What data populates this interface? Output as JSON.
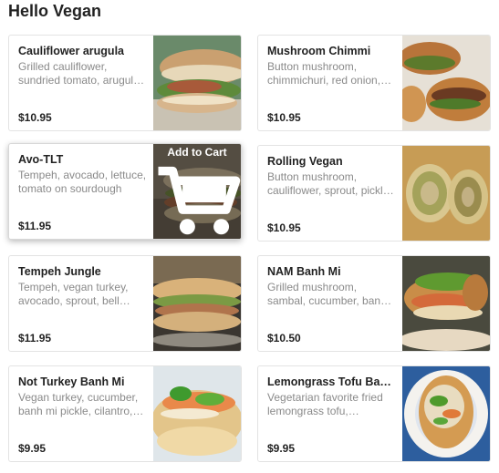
{
  "header": {
    "title": "Hello Vegan"
  },
  "menu_items": [
    {
      "name": "Cauliflower arugula",
      "description": "Grilled cauliflower, sundried tomato, arugula, pickled onion",
      "price": "$10.95"
    },
    {
      "name": "Mushroom Chimmi",
      "description": "Button mushroom, chimmichuri, red onion, arugula",
      "price": "$10.95"
    },
    {
      "name": "Avo-TLT",
      "description": "Tempeh, avocado, lettuce, tomato on sourdough",
      "price": "$11.95",
      "hover_label": "Add to Cart"
    },
    {
      "name": "Rolling Vegan",
      "description": "Button mushroom, cauliflower, sprout, pickled onion",
      "price": "$10.95"
    },
    {
      "name": "Tempeh Jungle",
      "description": "Tempeh, vegan turkey, avocado, sprout, bell pepper",
      "price": "$11.95"
    },
    {
      "name": "NAM Banh Mi",
      "description": "Grilled mushroom, sambal, cucumber, banh mi pickle, cilantro",
      "price": "$10.50"
    },
    {
      "name": "Not Turkey Banh Mi",
      "description": "Vegan turkey, cucumber, banh mi pickle, cilantro, jalapeno",
      "price": "$9.95"
    },
    {
      "name": "Lemongrass Tofu Banh Mi",
      "description": "Vegetarian favorite fried lemongrass tofu, cucumber, pickle",
      "price": "$9.95"
    }
  ],
  "icons": {
    "cart": "shopping-cart-icon"
  },
  "colors": {
    "card_border": "#e3e3e3",
    "description_text": "#8a8a8a",
    "overlay": "rgba(30,25,20,0.5)"
  }
}
